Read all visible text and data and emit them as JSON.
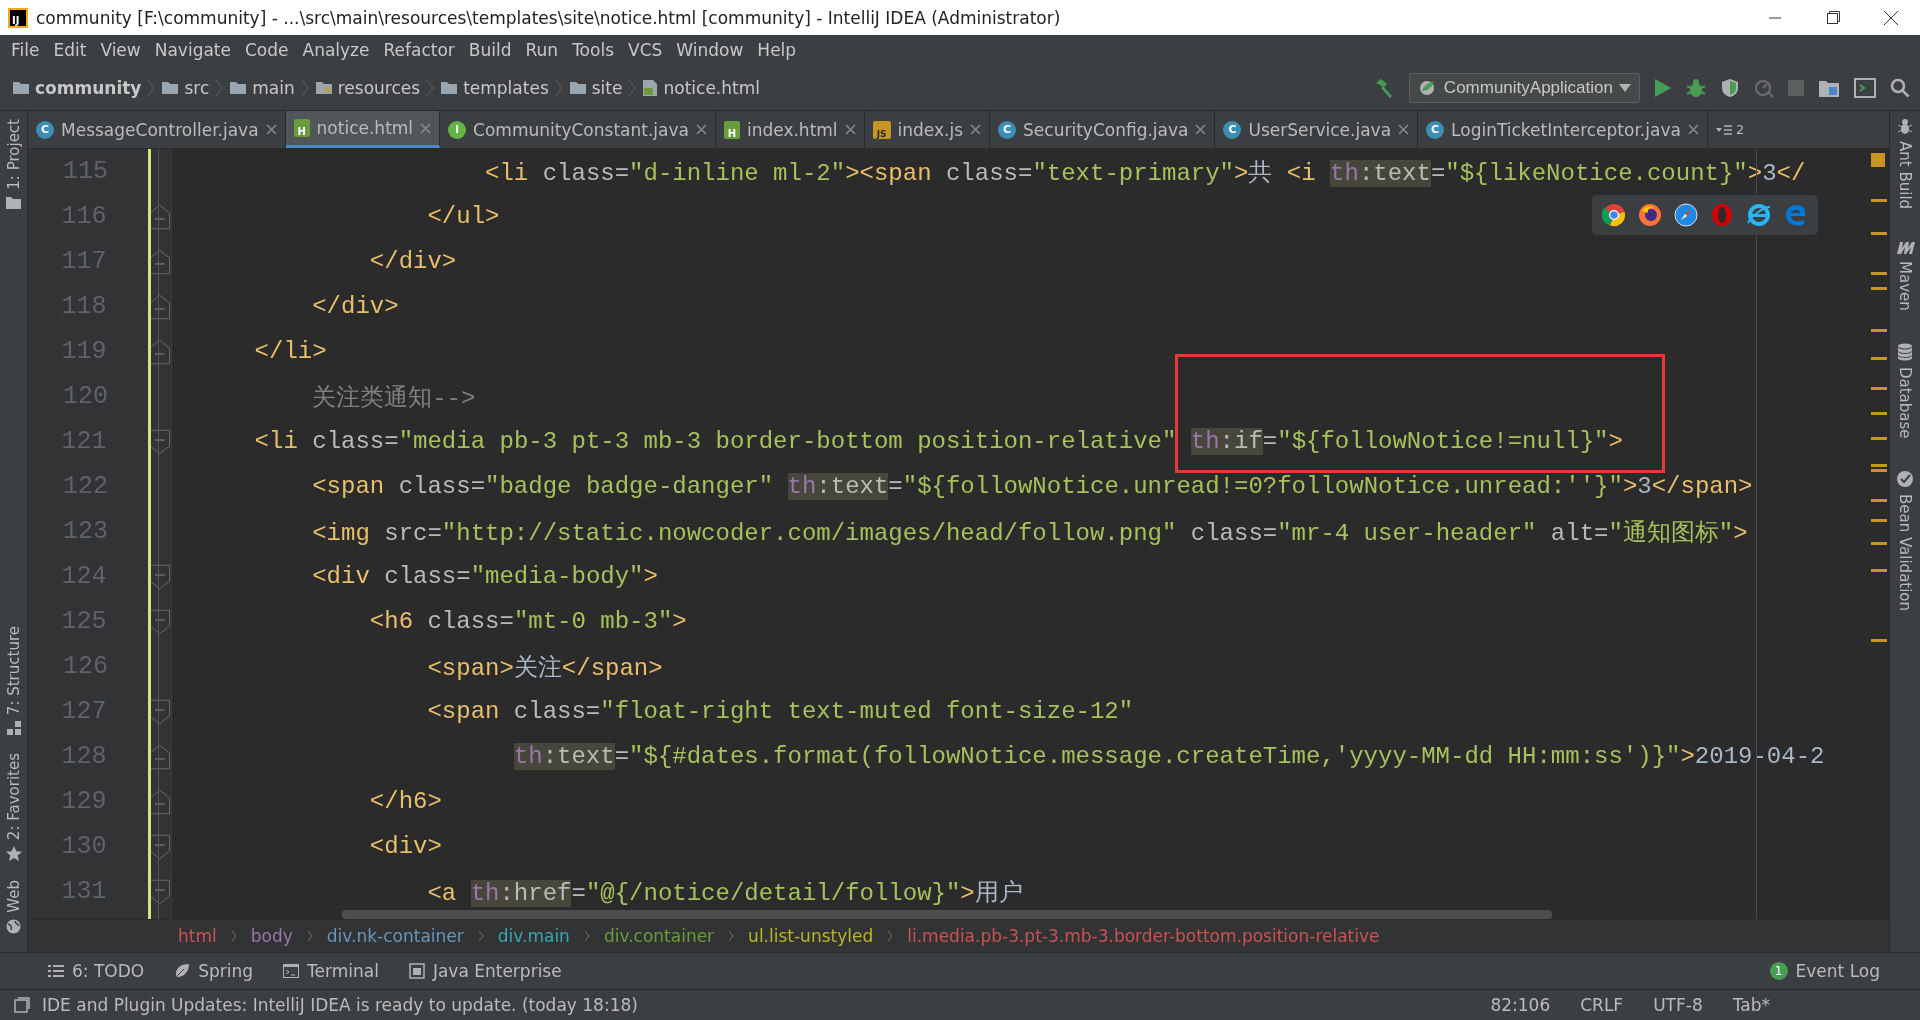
{
  "window": {
    "logo": "IJ",
    "title": "community [F:\\community] - ...\\src\\main\\resources\\templates\\site\\notice.html [community] - IntelliJ IDEA (Administrator)"
  },
  "menu": [
    "File",
    "Edit",
    "View",
    "Navigate",
    "Code",
    "Analyze",
    "Refactor",
    "Build",
    "Run",
    "Tools",
    "VCS",
    "Window",
    "Help"
  ],
  "navigation": {
    "path": [
      {
        "label": "community",
        "kind": "project"
      },
      {
        "label": "src",
        "kind": "folder"
      },
      {
        "label": "main",
        "kind": "folder"
      },
      {
        "label": "resources",
        "kind": "resources"
      },
      {
        "label": "templates",
        "kind": "folder"
      },
      {
        "label": "site",
        "kind": "folder"
      },
      {
        "label": "notice.html",
        "kind": "file"
      }
    ],
    "run_config": "CommunityApplication"
  },
  "tabs": [
    {
      "label": "MessageController.java",
      "kind": "class",
      "icon": "C",
      "selected": false
    },
    {
      "label": "notice.html",
      "kind": "html",
      "icon": "H",
      "selected": true
    },
    {
      "label": "CommunityConstant.java",
      "kind": "interface",
      "icon": "I",
      "selected": false
    },
    {
      "label": "index.html",
      "kind": "html",
      "icon": "H",
      "selected": false
    },
    {
      "label": "index.js",
      "kind": "js",
      "icon": "JS",
      "selected": false
    },
    {
      "label": "SecurityConfig.java",
      "kind": "class",
      "icon": "C",
      "selected": false
    },
    {
      "label": "UserService.java",
      "kind": "class",
      "icon": "C",
      "selected": false
    },
    {
      "label": "LoginTicketInterceptor.java",
      "kind": "class",
      "icon": "C",
      "selected": false
    }
  ],
  "tabs_overflow": "2",
  "left_tools": [
    {
      "label": "1: Project",
      "kind": "project"
    },
    {
      "label": "7: Structure",
      "kind": "structure"
    },
    {
      "label": "2: Favorites",
      "kind": "favorites"
    },
    {
      "label": "Web",
      "kind": "web"
    }
  ],
  "right_tools": [
    {
      "label": "Ant Build",
      "kind": "ant"
    },
    {
      "label": "Maven",
      "kind": "maven"
    },
    {
      "label": "Database",
      "kind": "database"
    },
    {
      "label": "Bean Validation",
      "kind": "bean"
    }
  ],
  "editor": {
    "lines": [
      {
        "number": "115",
        "tokens": [
          {
            "kind": "tag",
            "t": "                    <li"
          },
          {
            "kind": "attr",
            "t": " class="
          },
          {
            "kind": "value",
            "t": "\"d-inline ml-2\""
          },
          {
            "kind": "tag",
            "t": "><span"
          },
          {
            "kind": "attr",
            "t": " class="
          },
          {
            "kind": "value",
            "t": "\"text-primary\""
          },
          {
            "kind": "tag",
            "t": ">"
          },
          {
            "kind": "text",
            "t": "共 "
          },
          {
            "kind": "tag",
            "t": "<i "
          },
          {
            "kind": "ns",
            "t": "th"
          },
          {
            "kind": "thattr",
            "t": ":text"
          },
          {
            "kind": "attr",
            "t": "="
          },
          {
            "kind": "value",
            "t": "\"${likeNotice.count}\""
          },
          {
            "kind": "tag",
            "t": ">"
          },
          {
            "kind": "text",
            "t": "3"
          },
          {
            "kind": "tag",
            "t": "</"
          }
        ]
      },
      {
        "number": "116",
        "kind": "block_end",
        "tokens": [
          {
            "kind": "tag",
            "t": "                </ul>"
          }
        ]
      },
      {
        "number": "117",
        "kind": "block_end",
        "tokens": [
          {
            "kind": "tag",
            "t": "            </div>"
          }
        ]
      },
      {
        "number": "118",
        "kind": "block_end",
        "tokens": [
          {
            "kind": "tag",
            "t": "        </div>"
          }
        ]
      },
      {
        "number": "119",
        "kind": "block_end",
        "tokens": [
          {
            "kind": "tag",
            "t": "    </li>"
          }
        ]
      },
      {
        "number": "120",
        "tokens": [
          {
            "kind": "comment",
            "t": "        关注类通知-->"
          }
        ]
      },
      {
        "number": "121",
        "kind": "block_start",
        "tokens": [
          {
            "kind": "tag",
            "t": "    <li"
          },
          {
            "kind": "attr",
            "t": " class="
          },
          {
            "kind": "value",
            "t": "\"media pb-3 pt-3 mb-3 border-bottom position-relative\" "
          },
          {
            "kind": "ns",
            "t": "th"
          },
          {
            "kind": "thattr",
            "t": ":if"
          },
          {
            "kind": "attr",
            "t": "="
          },
          {
            "kind": "value",
            "t": "\"${followNotice!=null}\""
          },
          {
            "kind": "tag",
            "t": ">"
          }
        ]
      },
      {
        "number": "122",
        "tokens": [
          {
            "kind": "tag",
            "t": "        <span"
          },
          {
            "kind": "attr",
            "t": " class="
          },
          {
            "kind": "value",
            "t": "\"badge badge-danger\" "
          },
          {
            "kind": "ns",
            "t": "th"
          },
          {
            "kind": "thattr",
            "t": ":text"
          },
          {
            "kind": "attr",
            "t": "="
          },
          {
            "kind": "value",
            "t": "\"${followNotice.unread!=0?followNotice.unread:''}\""
          },
          {
            "kind": "tag",
            "t": ">"
          },
          {
            "kind": "text",
            "t": "3"
          },
          {
            "kind": "tag",
            "t": "</span>"
          }
        ]
      },
      {
        "number": "123",
        "tokens": [
          {
            "kind": "tag",
            "t": "        <img"
          },
          {
            "kind": "attr",
            "t": " src="
          },
          {
            "kind": "value",
            "t": "\"http://static.nowcoder.com/images/head/follow.png\""
          },
          {
            "kind": "attr",
            "t": " class="
          },
          {
            "kind": "value",
            "t": "\"mr-4 user-header\""
          },
          {
            "kind": "attr",
            "t": " alt="
          },
          {
            "kind": "value",
            "t": "\"通知图标\""
          },
          {
            "kind": "tag",
            "t": ">"
          }
        ]
      },
      {
        "number": "124",
        "kind": "block_start",
        "tokens": [
          {
            "kind": "tag",
            "t": "        <div"
          },
          {
            "kind": "attr",
            "t": " class="
          },
          {
            "kind": "value",
            "t": "\"media-body\""
          },
          {
            "kind": "tag",
            "t": ">"
          }
        ]
      },
      {
        "number": "125",
        "kind": "block_start",
        "tokens": [
          {
            "kind": "tag",
            "t": "            <h6"
          },
          {
            "kind": "attr",
            "t": " class="
          },
          {
            "kind": "value",
            "t": "\"mt-0 mb-3\""
          },
          {
            "kind": "tag",
            "t": ">"
          }
        ]
      },
      {
        "number": "126",
        "tokens": [
          {
            "kind": "tag",
            "t": "                <span>"
          },
          {
            "kind": "text",
            "t": "关注"
          },
          {
            "kind": "tag",
            "t": "</span>"
          }
        ]
      },
      {
        "number": "127",
        "kind": "block_start",
        "tokens": [
          {
            "kind": "tag",
            "t": "                <span"
          },
          {
            "kind": "attr",
            "t": " class="
          },
          {
            "kind": "value",
            "t": "\"float-right text-muted font-size-12\""
          }
        ]
      },
      {
        "number": "128",
        "kind": "block_end",
        "continuation": true,
        "tokens": [
          {
            "kind": "ns",
            "t": "th"
          },
          {
            "kind": "thattr",
            "t": ":text"
          },
          {
            "kind": "attr",
            "t": "="
          },
          {
            "kind": "value",
            "t": "\"${#dates.format(followNotice.message.createTime,'yyyy-MM-dd HH:mm:ss')}\""
          },
          {
            "kind": "tag",
            "t": ">"
          },
          {
            "kind": "text",
            "t": "2019-04-2"
          }
        ]
      },
      {
        "number": "129",
        "kind": "block_end",
        "tokens": [
          {
            "kind": "tag",
            "t": "            </h6>"
          }
        ]
      },
      {
        "number": "130",
        "kind": "block_start",
        "tokens": [
          {
            "kind": "tag",
            "t": "            <div>"
          }
        ]
      },
      {
        "number": "131",
        "kind": "block_start",
        "tokens": [
          {
            "kind": "tag",
            "t": "                <a "
          },
          {
            "kind": "ns",
            "t": "th"
          },
          {
            "kind": "thattr",
            "t": ":href"
          },
          {
            "kind": "attr",
            "t": "="
          },
          {
            "kind": "value",
            "t": "\"@{/notice/detail/follow}\""
          },
          {
            "kind": "tag",
            "t": ">"
          },
          {
            "kind": "text",
            "t": "用户"
          }
        ]
      }
    ]
  },
  "breadcrumbs": [
    {
      "label": "html",
      "color": "#c75450"
    },
    {
      "label": "body",
      "color": "#9876aa"
    },
    {
      "label": "div.nk-container",
      "color": "#6897bb"
    },
    {
      "label": "div.main",
      "color": "#3aa5b0"
    },
    {
      "label": "div.container",
      "color": "#6a9b3c"
    },
    {
      "label": "ul.list-unstyled",
      "color": "#bbb529"
    },
    {
      "label": "li.media.pb-3.pt-3.mb-3.border-bottom.position-relative",
      "color": "#c75450"
    }
  ],
  "tool_windows": [
    {
      "label": "6: TODO",
      "kind": "todo"
    },
    {
      "label": "Spring",
      "kind": "spring"
    },
    {
      "label": "Terminal",
      "kind": "terminal"
    },
    {
      "label": "Java Enterprise",
      "kind": "enterprise"
    }
  ],
  "event_log": {
    "label": "Event Log",
    "count": "1"
  },
  "status": {
    "message": "IDE and Plugin Updates: IntelliJ IDEA is ready to update. (today 18:18)",
    "position": "82:106",
    "line_separator": "CRLF",
    "encoding": "UTF-8",
    "indent": "Tab*"
  }
}
